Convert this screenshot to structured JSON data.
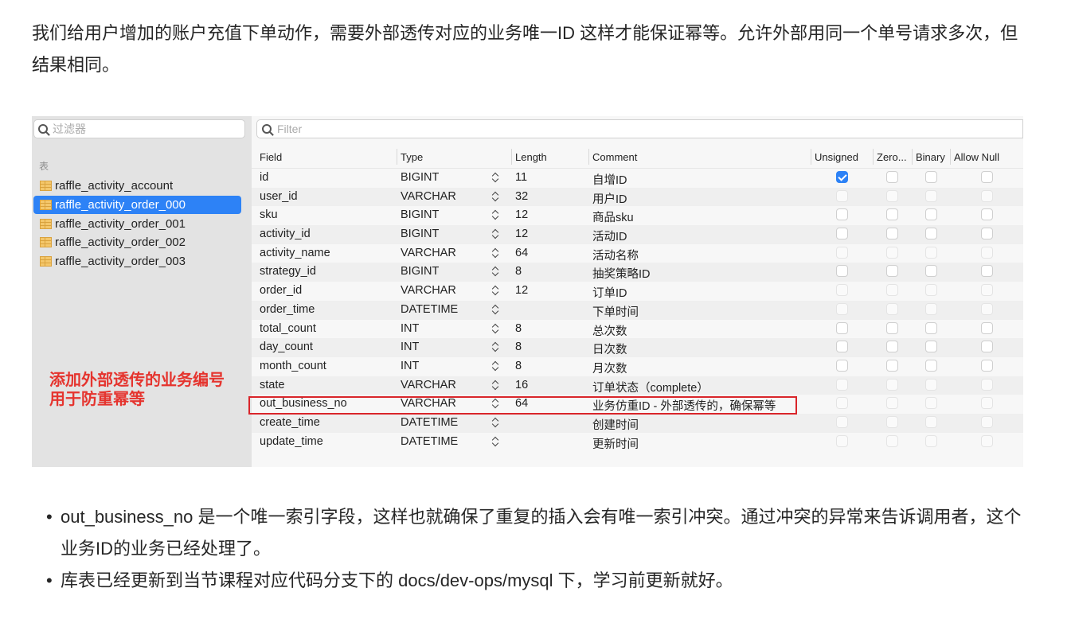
{
  "intro_text": "我们给用户增加的账户充值下单动作，需要外部透传对应的业务唯一ID 这样才能保证幂等。允许外部用同一个单号请求多次，但结果相同。",
  "sidebar": {
    "filter_placeholder": "过滤器",
    "heading": "表",
    "tables": [
      "raffle_activity_account",
      "raffle_activity_order_000",
      "raffle_activity_order_001",
      "raffle_activity_order_002",
      "raffle_activity_order_003"
    ],
    "selected_index": 1
  },
  "main": {
    "filter_placeholder": "Filter",
    "columns": {
      "field": "Field",
      "type": "Type",
      "length": "Length",
      "comment": "Comment",
      "unsigned": "Unsigned",
      "zerofill": "Zero...",
      "binary": "Binary",
      "allow_null": "Allow Null"
    },
    "rows": [
      {
        "field": "id",
        "type": "BIGINT",
        "length": "11",
        "comment": "自增ID",
        "unsigned": true,
        "active": true
      },
      {
        "field": "user_id",
        "type": "VARCHAR",
        "length": "32",
        "comment": "用户ID",
        "unsigned": false,
        "active": false
      },
      {
        "field": "sku",
        "type": "BIGINT",
        "length": "12",
        "comment": "商品sku",
        "unsigned": false,
        "active": true
      },
      {
        "field": "activity_id",
        "type": "BIGINT",
        "length": "12",
        "comment": "活动ID",
        "unsigned": false,
        "active": true
      },
      {
        "field": "activity_name",
        "type": "VARCHAR",
        "length": "64",
        "comment": "活动名称",
        "unsigned": false,
        "active": false
      },
      {
        "field": "strategy_id",
        "type": "BIGINT",
        "length": "8",
        "comment": "抽奖策略ID",
        "unsigned": false,
        "active": true
      },
      {
        "field": "order_id",
        "type": "VARCHAR",
        "length": "12",
        "comment": "订单ID",
        "unsigned": false,
        "active": false
      },
      {
        "field": "order_time",
        "type": "DATETIME",
        "length": "",
        "comment": "下单时间",
        "unsigned": false,
        "active": false
      },
      {
        "field": "total_count",
        "type": "INT",
        "length": "8",
        "comment": "总次数",
        "unsigned": false,
        "active": true
      },
      {
        "field": "day_count",
        "type": "INT",
        "length": "8",
        "comment": "日次数",
        "unsigned": false,
        "active": true
      },
      {
        "field": "month_count",
        "type": "INT",
        "length": "8",
        "comment": "月次数",
        "unsigned": false,
        "active": true
      },
      {
        "field": "state",
        "type": "VARCHAR",
        "length": "16",
        "comment": "订单状态（complete）",
        "unsigned": false,
        "active": false
      },
      {
        "field": "out_business_no",
        "type": "VARCHAR",
        "length": "64",
        "comment": "业务仿重ID - 外部透传的，确保幂等",
        "unsigned": false,
        "active": false
      },
      {
        "field": "create_time",
        "type": "DATETIME",
        "length": "",
        "comment": "创建时间",
        "unsigned": false,
        "active": false
      },
      {
        "field": "update_time",
        "type": "DATETIME",
        "length": "",
        "comment": "更新时间",
        "unsigned": false,
        "active": false
      }
    ]
  },
  "annotation": {
    "line1": "添加外部透传的业务编号",
    "line2": "用于防重幂等"
  },
  "bullets": [
    "out_business_no 是一个唯一索引字段，这样也就确保了重复的插入会有唯一索引冲突。通过冲突的异常来告诉调用者，这个业务ID的业务已经处理了。",
    "库表已经更新到当节课程对应代码分支下的 docs/dev-ops/mysql 下，学习前更新就好。"
  ],
  "colors": {
    "accent": "#2d82f6",
    "highlight": "#d9252a",
    "annotation_text": "#e5342e"
  }
}
